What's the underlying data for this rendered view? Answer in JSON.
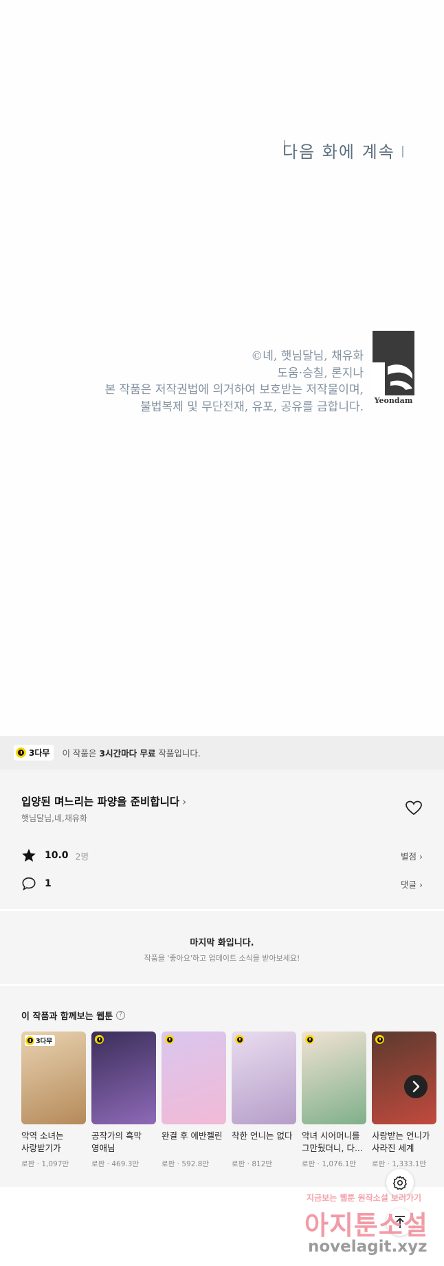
{
  "comic": {
    "next_episode": "다음 화에 계속",
    "copyright_lines": [
      "©녜, 햇님달님, 채유화",
      "도움·승칠, 론지나",
      "본 작품은 저작권법에 의거하여 보호받는 저작물이며,",
      "불법복제 및 무단전재, 유포, 공유를 금합니다."
    ],
    "logo_text": "Yeondam"
  },
  "free_banner": {
    "badge": "3다무",
    "text_prefix": "이 작품은 ",
    "text_bold": "3시간마다 무료",
    "text_suffix": " 작품입니다."
  },
  "work": {
    "title": "입양된 며느리는 파양을 준비합니다",
    "authors": "햇님달님,녜,채유화",
    "rating": "10.0",
    "rating_count": "2명",
    "rating_link": "별점 ›",
    "comment_count": "1",
    "comment_link": "댓글 ›"
  },
  "last_episode": {
    "title": "마지막 화입니다.",
    "subtitle": "작품을 '좋아요'하고 업데이트 소식을 받아보세요!"
  },
  "recommendations": {
    "heading": "이 작품과 함께보는 웹툰",
    "items": [
      {
        "title": "악역 소녀는 사랑받기가 부끄러...",
        "meta": "로판 · 1,097만",
        "badge": "3다무",
        "color_a": "#e8d2b0",
        "color_b": "#b58a5a"
      },
      {
        "title": "공작가의 흑막 영애님",
        "meta": "로판 · 469.3만",
        "badge": "",
        "color_a": "#3b2e5a",
        "color_b": "#8e6ab8"
      },
      {
        "title": "완결 후 에반젤린",
        "meta": "로판 · 592.8만",
        "badge": "",
        "color_a": "#d9c6ee",
        "color_b": "#f2b9d6"
      },
      {
        "title": "착한 언니는 없다",
        "meta": "로판 · 812만",
        "badge": "",
        "color_a": "#e9dcef",
        "color_b": "#b59ec9"
      },
      {
        "title": "악녀 시어머니를 그만뒀더니, 다...",
        "meta": "로판 · 1,076.1만",
        "badge": "",
        "color_a": "#f1e2d4",
        "color_b": "#7fb08a"
      },
      {
        "title": "사랑받는 언니가 사라진 세계",
        "meta": "로판 · 1,333.1만",
        "badge": "",
        "color_a": "#5b3a2e",
        "color_b": "#c24a3e"
      }
    ]
  },
  "watermark": {
    "line1": "지금보는 웹툰 원작소설 보러가기",
    "line2": "아지툰소설",
    "line3": "novelagit.xyz"
  },
  "icons": {
    "heart": "heart-outline-icon",
    "star": "star-icon",
    "comment": "speech-bubble-icon",
    "settings": "gear-icon",
    "top": "arrow-up-icon",
    "next": "chevron-right-icon"
  }
}
